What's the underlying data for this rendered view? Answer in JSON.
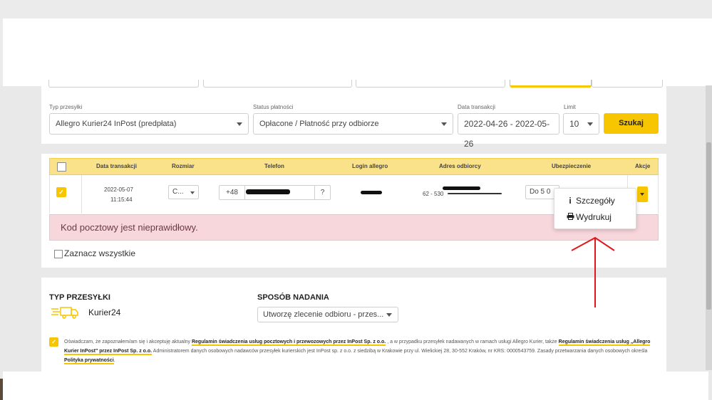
{
  "filters": {
    "parcel_type_label": "Typ przesyłki",
    "parcel_type_value": "Allegro Kurier24 InPost (predpłata)",
    "payment_status_label": "Status płatności",
    "payment_status_value": "Opłacone / Płatność przy odbiorze",
    "date_label": "Data transakcji",
    "date_value": "2022-04-26 - 2022-05-26",
    "limit_label": "Limit",
    "limit_value": "10",
    "search_button": "Szukaj"
  },
  "table": {
    "headers": [
      "Data transakcji",
      "Rozmiar",
      "Telefon",
      "Login allegro",
      "Adres odbiorcy",
      "Ubezpieczenie",
      "Akcje"
    ],
    "row": {
      "date": "2022-05-07",
      "time": "11:15:44",
      "size": "C...",
      "phone_prefix": "+48",
      "phone_help": "?",
      "address_zip": "62 - 530",
      "insurance": "Do 5 0"
    },
    "actions_menu": [
      {
        "label": "Szczegóły",
        "icon": "info-icon"
      },
      {
        "label": "Wydrukuj",
        "icon": "print-icon"
      }
    ],
    "error_message": "Kod pocztowy jest nieprawidłowy.",
    "select_all_label": "Zaznacz wszystkie"
  },
  "shipment": {
    "type_heading": "TYP PRZESYŁKI",
    "courier_name": "Kurier24",
    "method_heading": "SPOSÓB NADANIA",
    "method_value": "Utworzę zlecenie odbioru - przes...",
    "consent_part1": "Oświadczam, że zapoznałem/am się i akceptuję aktualny ",
    "consent_link1": "Regulamin świadczenia usług pocztowych i przewozowych przez InPost Sp. z o.o.",
    "consent_part2": " , a w przypadku przesyłek nadawanych w ramach usługi Allegro Kurier, także ",
    "consent_link2": "Regulamin świadczenia usług „Allegro Kurier InPost\" przez InPost Sp. z o.o.",
    "consent_part3": " Administratorem danych osobowych nadawców przesyłek kurierskich jest InPost sp. z o.o. z siedzibą w Krakowie przy ul. Wielickiej 28, 30-552 Kraków, nr KRS: 0000543759. Zasady przetwarzania danych osobowych określa ",
    "consent_link3": "Polityka prywatności",
    "consent_part4": "."
  },
  "colors": {
    "accent": "#f7c600",
    "header_bg": "#f9e28a",
    "alert_bg": "#f7d7dc",
    "annotation": "#e0161b"
  }
}
